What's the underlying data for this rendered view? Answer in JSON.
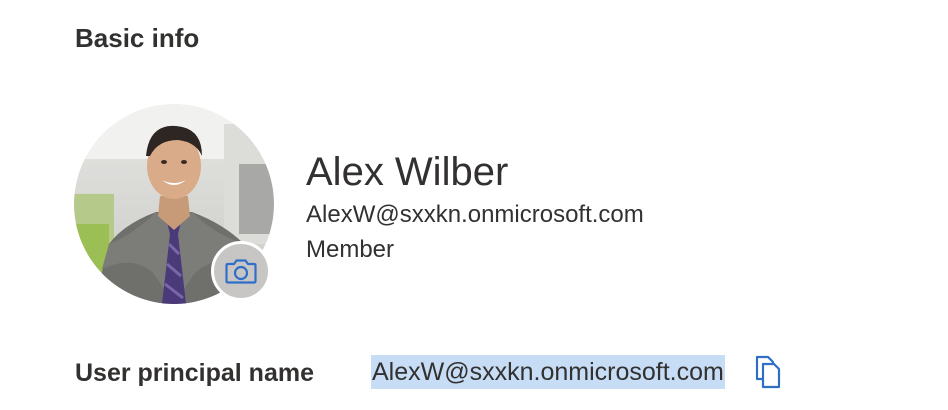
{
  "section": {
    "title": "Basic info"
  },
  "profile": {
    "name": "Alex Wilber",
    "email": "AlexW@sxxkn.onmicrosoft.com",
    "user_type": "Member",
    "avatar_icon": "profile-photo",
    "change_photo_icon": "camera-icon"
  },
  "fields": {
    "upn_label": "User principal name",
    "upn_value": "AlexW@sxxkn.onmicrosoft.com",
    "copy_icon": "copy-icon"
  },
  "colors": {
    "text": "#323130",
    "selection_highlight": "#c7dcf5",
    "icon_blue": "#2f6fc7",
    "camera_badge_bg": "#c8c6c4"
  }
}
